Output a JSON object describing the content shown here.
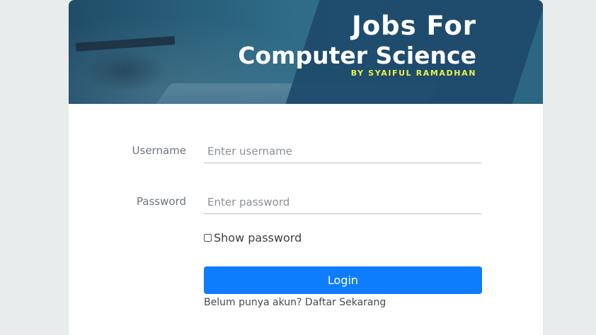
{
  "banner": {
    "title_line1": "Jobs For",
    "title_line2": "Computer Science",
    "byline": "BY SYAIFUL RAMADHAN"
  },
  "form": {
    "username_label": "Username",
    "username_placeholder": "Enter username",
    "username_value": "",
    "password_label": "Password",
    "password_placeholder": "Enter password",
    "password_value": "",
    "show_password_label": "Show password",
    "show_password_checked": false,
    "login_label": "Login",
    "register_prompt": "Belum punya akun?",
    "register_link": "Daftar Sekarang"
  },
  "colors": {
    "page_background": "#e9eced",
    "banner_dark": "#1f4d68",
    "byline_yellow": "#e8f24a",
    "primary_button": "#0d7dfd"
  }
}
